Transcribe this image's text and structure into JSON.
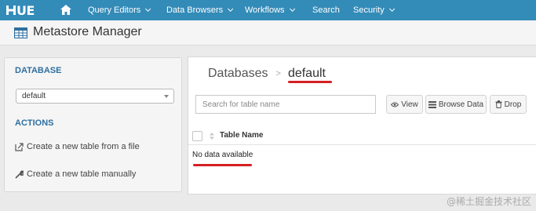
{
  "app": {
    "logo_text": "UE"
  },
  "nav": {
    "items": [
      {
        "label": "Query Editors",
        "has_caret": true
      },
      {
        "label": "Data Browsers",
        "has_caret": true
      },
      {
        "label": "Workflows",
        "has_caret": true
      },
      {
        "label": "Search",
        "has_caret": false
      },
      {
        "label": "Security",
        "has_caret": true
      }
    ]
  },
  "page": {
    "title": "Metastore Manager"
  },
  "sidebar": {
    "database_heading": "DATABASE",
    "database_selected": "default",
    "actions_heading": "ACTIONS",
    "actions": [
      {
        "label": "Create a new table from a file",
        "icon": "file-import-icon"
      },
      {
        "label": "Create a new table manually",
        "icon": "wrench-icon"
      }
    ]
  },
  "main": {
    "breadcrumb": {
      "root": "Databases",
      "separator": ">",
      "current": "default"
    },
    "search_placeholder": "Search for table name",
    "buttons": {
      "view": "View",
      "browse": "Browse Data",
      "drop": "Drop"
    },
    "table": {
      "columns": [
        "Table Name"
      ],
      "empty_message": "No data available"
    }
  },
  "watermark": "@稀土掘金技术社区",
  "colors": {
    "navbar": "#338bb8",
    "accent_text": "#2f6fa0",
    "annotation_red": "#d52024"
  }
}
